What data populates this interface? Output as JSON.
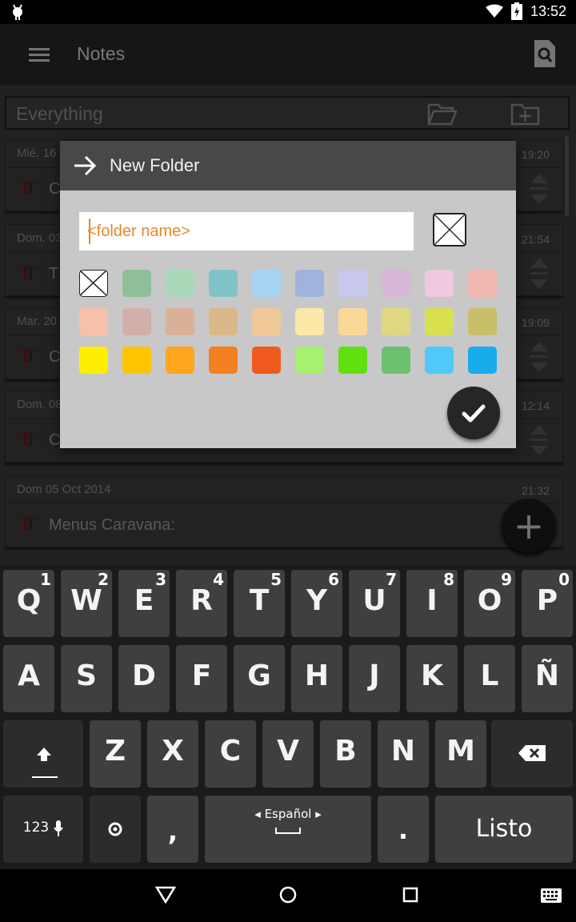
{
  "status_bar": {
    "time": "13:52"
  },
  "app_bar": {
    "title": "Notes"
  },
  "filter": {
    "label": "Everything"
  },
  "notes": [
    {
      "date": "Mié. 16",
      "time": "19:20",
      "preview": "C"
    },
    {
      "date": "Dom. 03",
      "time": "21:54",
      "preview": "T"
    },
    {
      "date": "Mar. 20",
      "time": "19:09",
      "preview": "C"
    },
    {
      "date": "Dom. 08",
      "time": "12:14",
      "preview": "C"
    },
    {
      "date": "Dom 05 Oct 2014",
      "time": "21:32",
      "preview": "Menus Caravana:"
    }
  ],
  "dialog": {
    "title": "New Folder",
    "placeholder": "<folder name>",
    "colors": [
      "none",
      "#8fbf98",
      "#a8d8b8",
      "#7fc3c8",
      "#a8d4f4",
      "#9fb3dc",
      "#c8c8ec",
      "#d8b8d8",
      "#f0c8e0",
      "#f0b8b0",
      "#f8c0a8",
      "#d0b0a8",
      "#dab098",
      "#d8b888",
      "#f0c898",
      "#fce8a8",
      "#fcd898",
      "#e0d880",
      "#d8e050",
      "#c8c068",
      "#ffee00",
      "#ffc400",
      "#ffa520",
      "#f48020",
      "#f05a1e",
      "#a8f070",
      "#60e010",
      "#6cc070",
      "#50c8f8",
      "#18acec"
    ]
  },
  "keyboard": {
    "row1": [
      {
        "label": "Q",
        "hint": "1"
      },
      {
        "label": "W",
        "hint": "2"
      },
      {
        "label": "E",
        "hint": "3"
      },
      {
        "label": "R",
        "hint": "4"
      },
      {
        "label": "T",
        "hint": "5"
      },
      {
        "label": "Y",
        "hint": "6"
      },
      {
        "label": "U",
        "hint": "7"
      },
      {
        "label": "I",
        "hint": "8"
      },
      {
        "label": "O",
        "hint": "9"
      },
      {
        "label": "P",
        "hint": "0"
      }
    ],
    "row2": [
      "A",
      "S",
      "D",
      "F",
      "G",
      "H",
      "J",
      "K",
      "L",
      "Ñ"
    ],
    "row3": [
      "Z",
      "X",
      "C",
      "V",
      "B",
      "N",
      "M"
    ],
    "numbers_label": "123",
    "comma": ",",
    "language": "Español",
    "period": ".",
    "done": "Listo"
  }
}
